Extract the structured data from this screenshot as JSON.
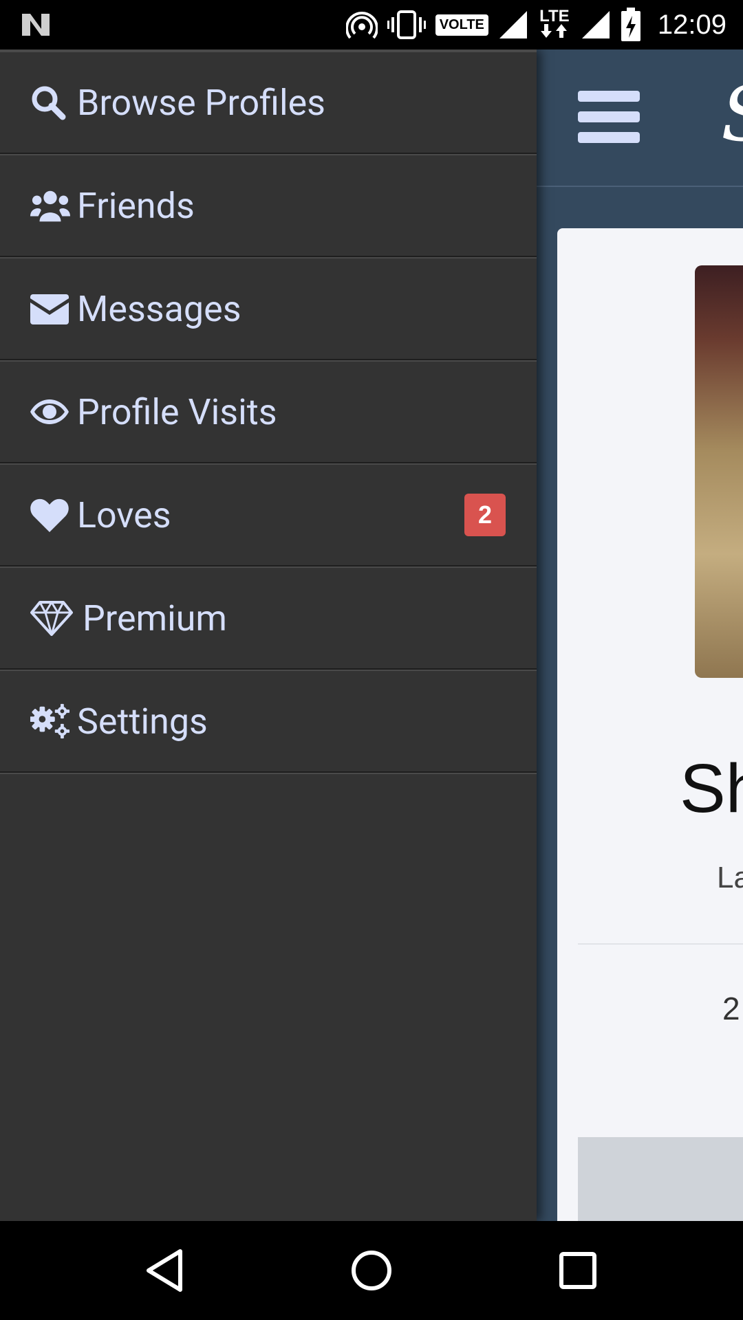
{
  "status_bar": {
    "time": "12:09",
    "volte": "VOLTE",
    "lte": "LTE",
    "icons": [
      "n-icon",
      "hotspot-icon",
      "vibrate-icon",
      "volte-icon",
      "signal-icon",
      "lte-icon",
      "signal-icon",
      "battery-charging-icon"
    ]
  },
  "drawer": {
    "items": [
      {
        "label": "Browse Profiles",
        "icon": "search-icon"
      },
      {
        "label": "Friends",
        "icon": "users-icon"
      },
      {
        "label": "Messages",
        "icon": "envelope-icon"
      },
      {
        "label": "Profile Visits",
        "icon": "eye-icon"
      },
      {
        "label": "Loves",
        "icon": "heart-icon",
        "badge": "2"
      },
      {
        "label": "Premium",
        "icon": "diamond-icon"
      },
      {
        "label": "Settings",
        "icon": "gears-icon"
      }
    ]
  },
  "app": {
    "logo_glyph": "S",
    "card": {
      "name": "Sh",
      "subtitle": "La",
      "number": "2"
    }
  },
  "colors": {
    "drawer_bg": "#333333",
    "drawer_text": "#d5defa",
    "app_header": "#34495e",
    "badge": "#d9534f"
  },
  "navbar": {
    "buttons": [
      "back-icon",
      "home-icon",
      "recents-icon"
    ]
  }
}
